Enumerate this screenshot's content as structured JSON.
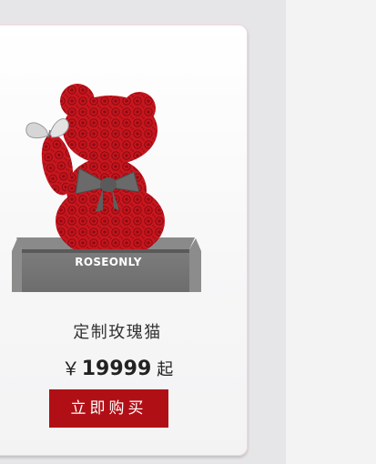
{
  "product": {
    "brand": "ROSEONLY",
    "name": "定制玫瑰猫",
    "currency": "￥",
    "price": "19999",
    "price_suffix": "起",
    "buy_label": "立即购买",
    "image": "rose-cat-in-gift-box"
  },
  "colors": {
    "accent": "#b10f16",
    "rose": "#c8161e",
    "box": "#727272",
    "bow": "#6a6a6a",
    "page_background": "#e6e6e8",
    "side_panel": "#f3f3f3"
  }
}
